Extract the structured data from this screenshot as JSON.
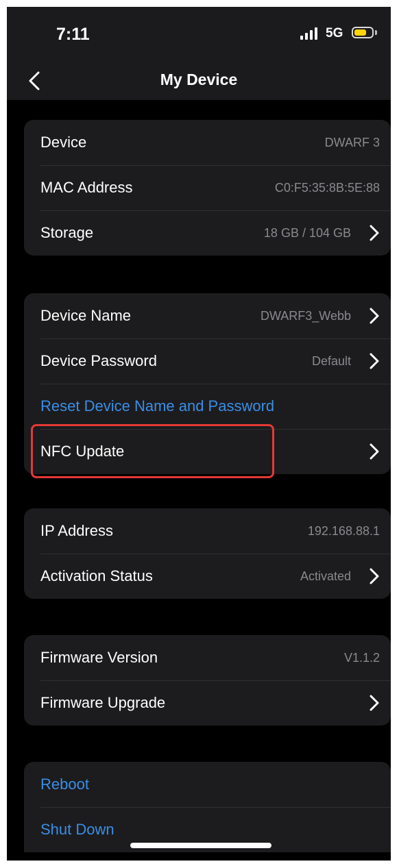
{
  "status": {
    "time": "7:11",
    "network": "5G"
  },
  "header": {
    "title": "My Device"
  },
  "device": {
    "device_label": "Device",
    "device_value": "DWARF 3",
    "mac_label": "MAC Address",
    "mac_value": "C0:F5:35:8B:5E:88",
    "storage_label": "Storage",
    "storage_value": "18 GB / 104 GB"
  },
  "account": {
    "name_label": "Device Name",
    "name_value": "DWARF3_Webb",
    "password_label": "Device Password",
    "password_value": "Default",
    "reset_label": "Reset Device Name and Password",
    "nfc_label": "NFC Update"
  },
  "network": {
    "ip_label": "IP Address",
    "ip_value": "192.168.88.1",
    "activation_label": "Activation Status",
    "activation_value": "Activated"
  },
  "firmware": {
    "version_label": "Firmware Version",
    "version_value": "V1.1.2",
    "upgrade_label": "Firmware Upgrade"
  },
  "power": {
    "reboot_label": "Reboot",
    "shutdown_label": "Shut Down"
  },
  "colors": {
    "accent": "#3a8ee6",
    "highlight": "#e53935",
    "battery": "#ffd60a",
    "card": "#1c1c1e"
  },
  "icons": [
    "signal-icon",
    "battery-icon",
    "back-chevron-icon",
    "chevron-right-icon"
  ]
}
